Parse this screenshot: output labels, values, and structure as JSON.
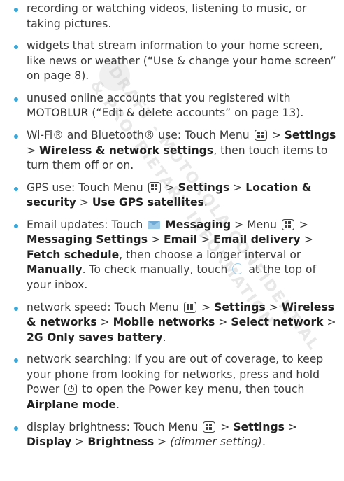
{
  "watermark": {
    "line1": "DRAFT - MOTOROLA CONFIDENTIAL",
    "line2": "& PROPRIETARY INFORMATION"
  },
  "items": [
    {
      "t": "recording or watching videos, listening to music, or taking pictures."
    },
    {
      "t1": "widgets that stream information to your home screen, like news or weather (“Use & change your home screen” on page 8)."
    },
    {
      "t1": "unused online accounts that you registered with MOTOBLUR (“Edit & delete accounts” on page 13)."
    },
    {
      "a": "Wi-Fi® and Bluetooth® use: Touch Menu",
      "gt1": ">",
      "b1": "Settings",
      "gt2": ">",
      "b2": "Wireless & network settings",
      "c": ", then touch items to turn them off or on."
    },
    {
      "a": "GPS use: Touch Menu",
      "gt1": ">",
      "b1": "Settings",
      "gt2": ">",
      "b2": "Location & security",
      "gt3": ">",
      "b3": "Use GPS satellites",
      "c": "."
    },
    {
      "a": "Email updates: Touch",
      "b1": "Messaging",
      "m1": "> Menu",
      "gt2": ">",
      "b2": "Messaging Settings",
      "gt3": ">",
      "b3": "Email",
      "gt4": ">",
      "b4": "Email delivery",
      "gt5": ">",
      "b5": "Fetch schedule",
      "c1": ", then choose a longer interval or",
      "b6": "Manually",
      "c2": ". To check manually, touch",
      "c3": "at the top of your inbox."
    },
    {
      "a": "network speed: Touch Menu",
      "gt1": ">",
      "b1": "Settings",
      "gt2": ">",
      "b2": "Wireless & networks",
      "gt3": ">",
      "b3": "Mobile networks",
      "gt4": ">",
      "b4": "Select network",
      "gt5": ">",
      "b5": "2G Only saves battery",
      "c": "."
    },
    {
      "a": "network searching: If you are out of coverage, to keep your phone from looking for networks, press and hold Power",
      "c1": "to open the Power key menu, then touch",
      "b1": "Airplane mode",
      "c2": "."
    },
    {
      "a": "display brightness: Touch Menu",
      "gt1": ">",
      "b1": "Settings",
      "gt2": ">",
      "b2": "Display",
      "gt3": ">",
      "b3": "Brightness",
      "gt4": ">",
      "i1": "(dimmer setting)",
      "c": "."
    }
  ]
}
